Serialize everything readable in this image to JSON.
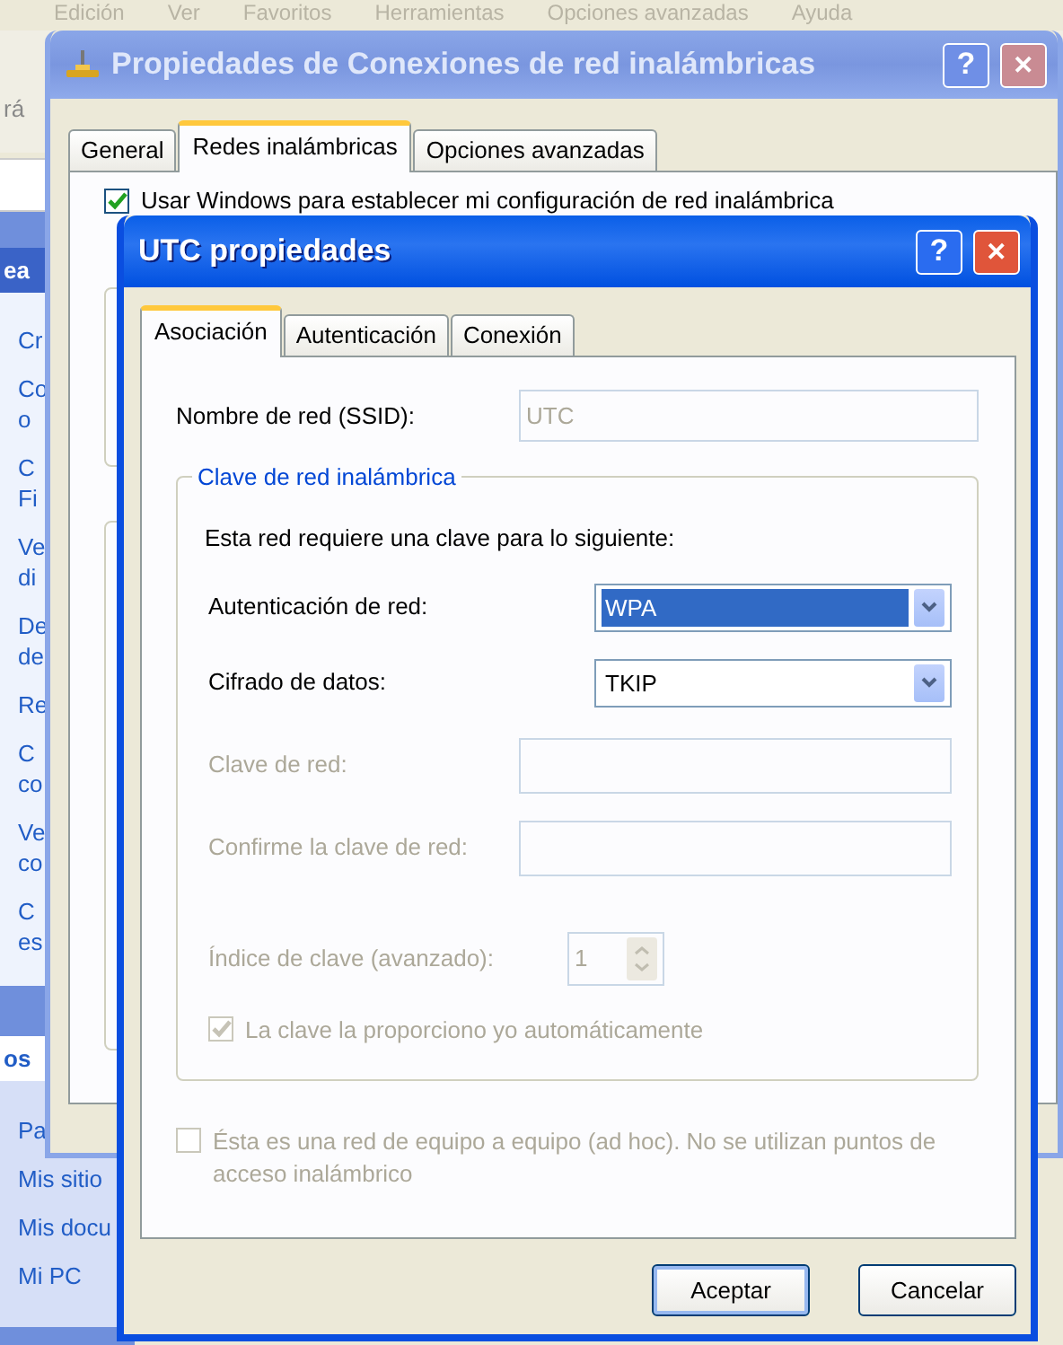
{
  "explorer": {
    "menu": [
      "Edición",
      "Ver",
      "Favoritos",
      "Herramientas",
      "Opciones avanzadas",
      "Ayuda"
    ],
    "toolbar_fragment": "rá",
    "sidebar": [
      {
        "kind": "header",
        "lines": [
          "ea"
        ]
      },
      {
        "kind": "link",
        "lines": [
          "Cr"
        ]
      },
      {
        "kind": "link",
        "lines": [
          "Co",
          "o"
        ]
      },
      {
        "kind": "link",
        "lines": [
          "C",
          "Fi"
        ]
      },
      {
        "kind": "link",
        "lines": [
          "Ve",
          "di"
        ]
      },
      {
        "kind": "link",
        "lines": [
          "De",
          "de"
        ]
      },
      {
        "kind": "link",
        "lines": [
          "Re"
        ]
      },
      {
        "kind": "link",
        "lines": [
          "C",
          "co"
        ]
      },
      {
        "kind": "link",
        "lines": [
          "Ve",
          "co"
        ]
      },
      {
        "kind": "link",
        "lines": [
          "C",
          "es"
        ]
      },
      {
        "kind": "header",
        "lines": [
          "os"
        ]
      },
      {
        "kind": "link",
        "lines": [
          "Pa"
        ]
      },
      {
        "kind": "link",
        "lines": [
          "Mis sitio"
        ]
      },
      {
        "kind": "link",
        "lines": [
          "Mis docu"
        ]
      },
      {
        "kind": "link",
        "lines": [
          "Mi PC"
        ]
      }
    ]
  },
  "back_dialog": {
    "title": "Propiedades de Conexiones de red inalámbricas",
    "help": "?",
    "close": "✕",
    "tabs": [
      {
        "label": "General",
        "selected": false
      },
      {
        "label": "Redes inalámbricas",
        "selected": true
      },
      {
        "label": "Opciones avanzadas",
        "selected": false
      }
    ],
    "checkbox": {
      "label": "Usar Windows para establecer mi configuración de red inalámbrica",
      "checked": true
    }
  },
  "dialog": {
    "title": "UTC propiedades",
    "help": "?",
    "close": "✕",
    "tabs": [
      {
        "label": "Asociación",
        "selected": true
      },
      {
        "label": "Autenticación",
        "selected": false
      },
      {
        "label": "Conexión",
        "selected": false
      }
    ],
    "ssid": {
      "label": "Nombre de red (SSID):",
      "value": "UTC",
      "disabled": true
    },
    "group": {
      "legend": "Clave de red inalámbrica",
      "intro": "Esta red requiere una clave para lo siguiente:",
      "fields": [
        {
          "kind": "select",
          "label": "Autenticación de red:",
          "value": "WPA",
          "highlighted": true,
          "disabled": false
        },
        {
          "kind": "select",
          "label": "Cifrado de datos:",
          "value": "TKIP",
          "highlighted": false,
          "disabled": false
        },
        {
          "kind": "input",
          "label": "Clave de red:",
          "disabled": true
        },
        {
          "kind": "input",
          "label": "Confirme la clave de red:",
          "disabled": true
        },
        {
          "kind": "spin",
          "label": "Índice de clave (avanzado):",
          "value": "1",
          "disabled": true
        },
        {
          "kind": "checkbox",
          "label": "La clave la proporciono yo automáticamente",
          "checked": true,
          "disabled": true
        }
      ]
    },
    "adhoc": {
      "label": "Ésta es una red de equipo a equipo (ad hoc). No se utilizan puntos de acceso inalámbrico",
      "checked": false,
      "disabled": true
    },
    "buttons": [
      {
        "label": "Aceptar",
        "default": true
      },
      {
        "label": "Cancelar",
        "default": false
      }
    ]
  }
}
